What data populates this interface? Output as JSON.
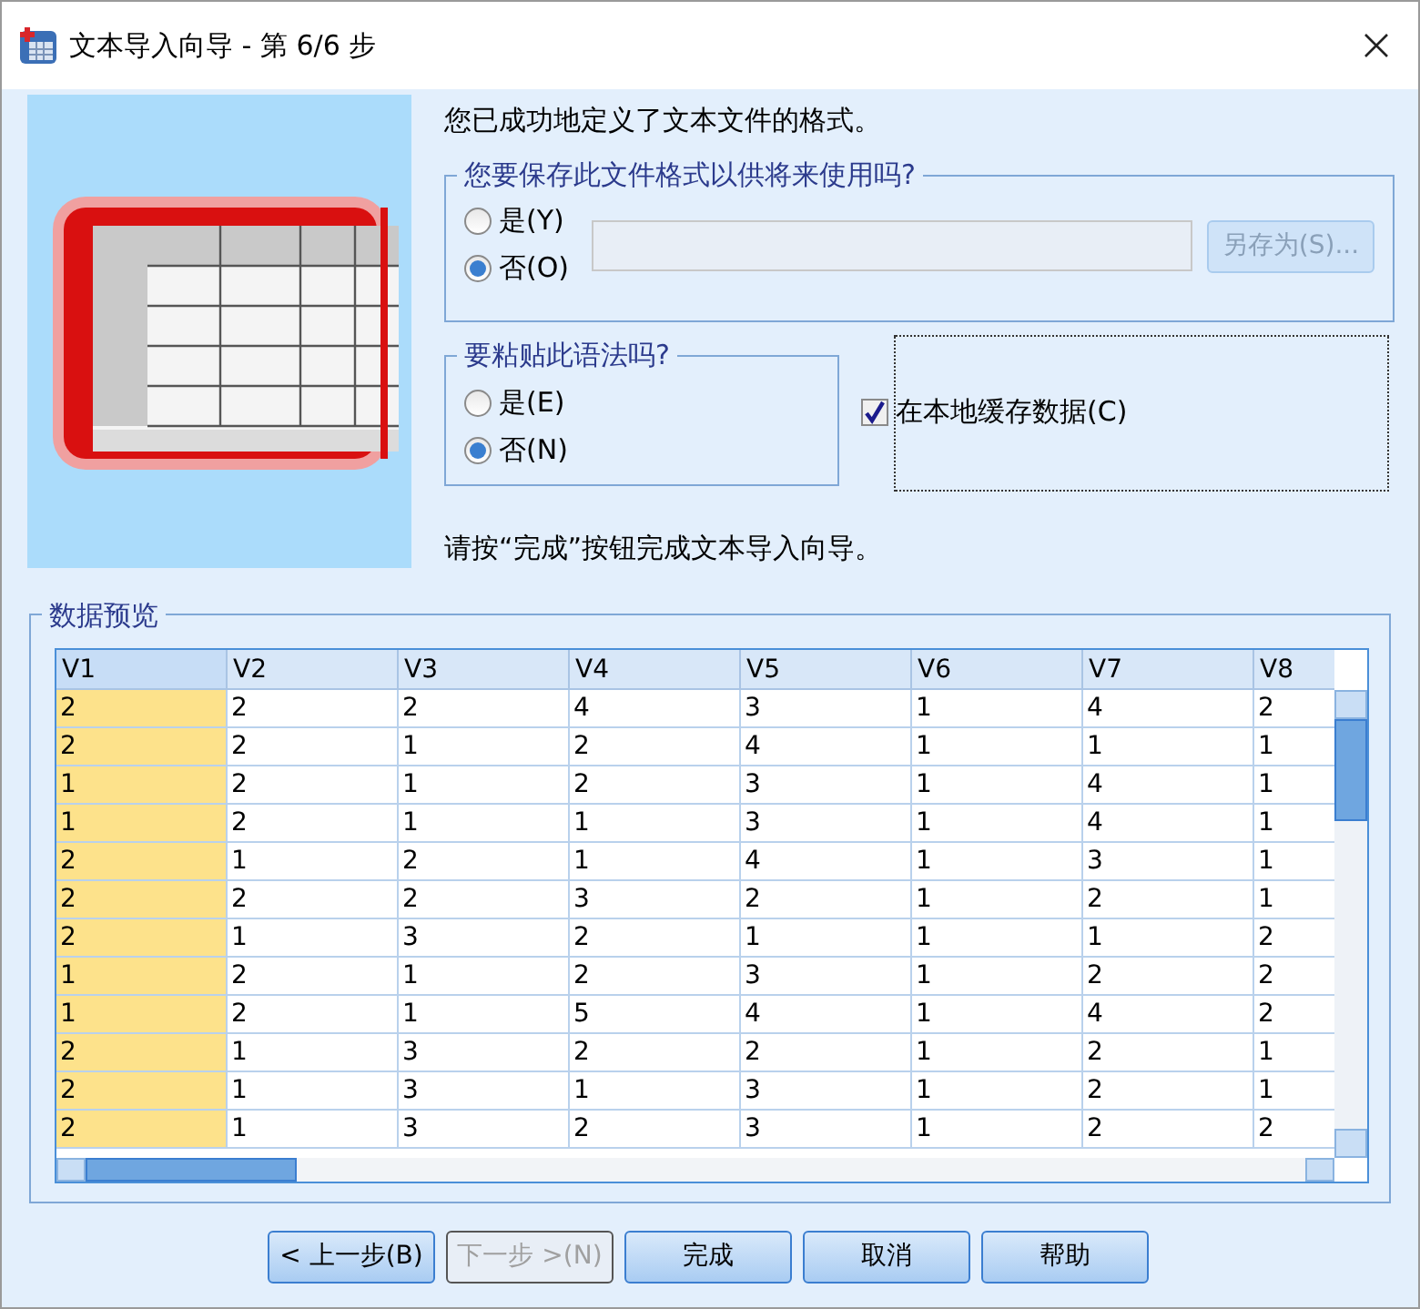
{
  "window": {
    "title": "文本导入向导 - 第 6/6 步"
  },
  "intro": "您已成功地定义了文本文件的格式。",
  "save_format": {
    "title": "您要保存此文件格式以供将来使用吗?",
    "options": [
      {
        "label": "是(Y)",
        "selected": false
      },
      {
        "label": "否(O)",
        "selected": true
      }
    ],
    "save_as_button": {
      "label": "另存为(S)...",
      "disabled": true
    }
  },
  "paste_syntax": {
    "title": "要粘贴此语法吗?",
    "options": [
      {
        "label": "是(E)",
        "selected": false
      },
      {
        "label": "否(N)",
        "selected": true
      }
    ]
  },
  "cache_data": {
    "label": "在本地缓存数据(C)",
    "checked": true
  },
  "finish_hint": "请按“完成”按钮完成文本导入向导。",
  "preview": {
    "title": "数据预览",
    "columns": [
      {
        "label": "V1",
        "selected": true
      },
      {
        "label": "V2",
        "selected": false
      },
      {
        "label": "V3",
        "selected": false
      },
      {
        "label": "V4",
        "selected": false
      },
      {
        "label": "V5",
        "selected": false
      },
      {
        "label": "V6",
        "selected": false
      },
      {
        "label": "V7",
        "selected": false
      },
      {
        "label": "V8",
        "selected": false
      }
    ],
    "rows": [
      [
        "2",
        "2",
        "2",
        "4",
        "3",
        "1",
        "4",
        "2"
      ],
      [
        "2",
        "2",
        "1",
        "2",
        "4",
        "1",
        "1",
        "1"
      ],
      [
        "1",
        "2",
        "1",
        "2",
        "3",
        "1",
        "4",
        "1"
      ],
      [
        "1",
        "2",
        "1",
        "1",
        "3",
        "1",
        "4",
        "1"
      ],
      [
        "2",
        "1",
        "2",
        "1",
        "4",
        "1",
        "3",
        "1"
      ],
      [
        "2",
        "2",
        "2",
        "3",
        "2",
        "1",
        "2",
        "1"
      ],
      [
        "2",
        "1",
        "3",
        "2",
        "1",
        "1",
        "1",
        "2"
      ],
      [
        "1",
        "2",
        "1",
        "2",
        "3",
        "1",
        "2",
        "2"
      ],
      [
        "1",
        "2",
        "1",
        "5",
        "4",
        "1",
        "4",
        "2"
      ],
      [
        "2",
        "1",
        "3",
        "2",
        "2",
        "1",
        "2",
        "1"
      ],
      [
        "2",
        "1",
        "3",
        "1",
        "3",
        "1",
        "2",
        "1"
      ],
      [
        "2",
        "1",
        "3",
        "2",
        "3",
        "1",
        "2",
        "2"
      ]
    ]
  },
  "buttons": [
    {
      "label": "< 上一步(B)",
      "disabled": false
    },
    {
      "label": "下一步 >(N)",
      "disabled": true
    },
    {
      "label": "完成",
      "disabled": false
    },
    {
      "label": "取消",
      "disabled": false
    },
    {
      "label": "帮助",
      "disabled": false
    }
  ]
}
